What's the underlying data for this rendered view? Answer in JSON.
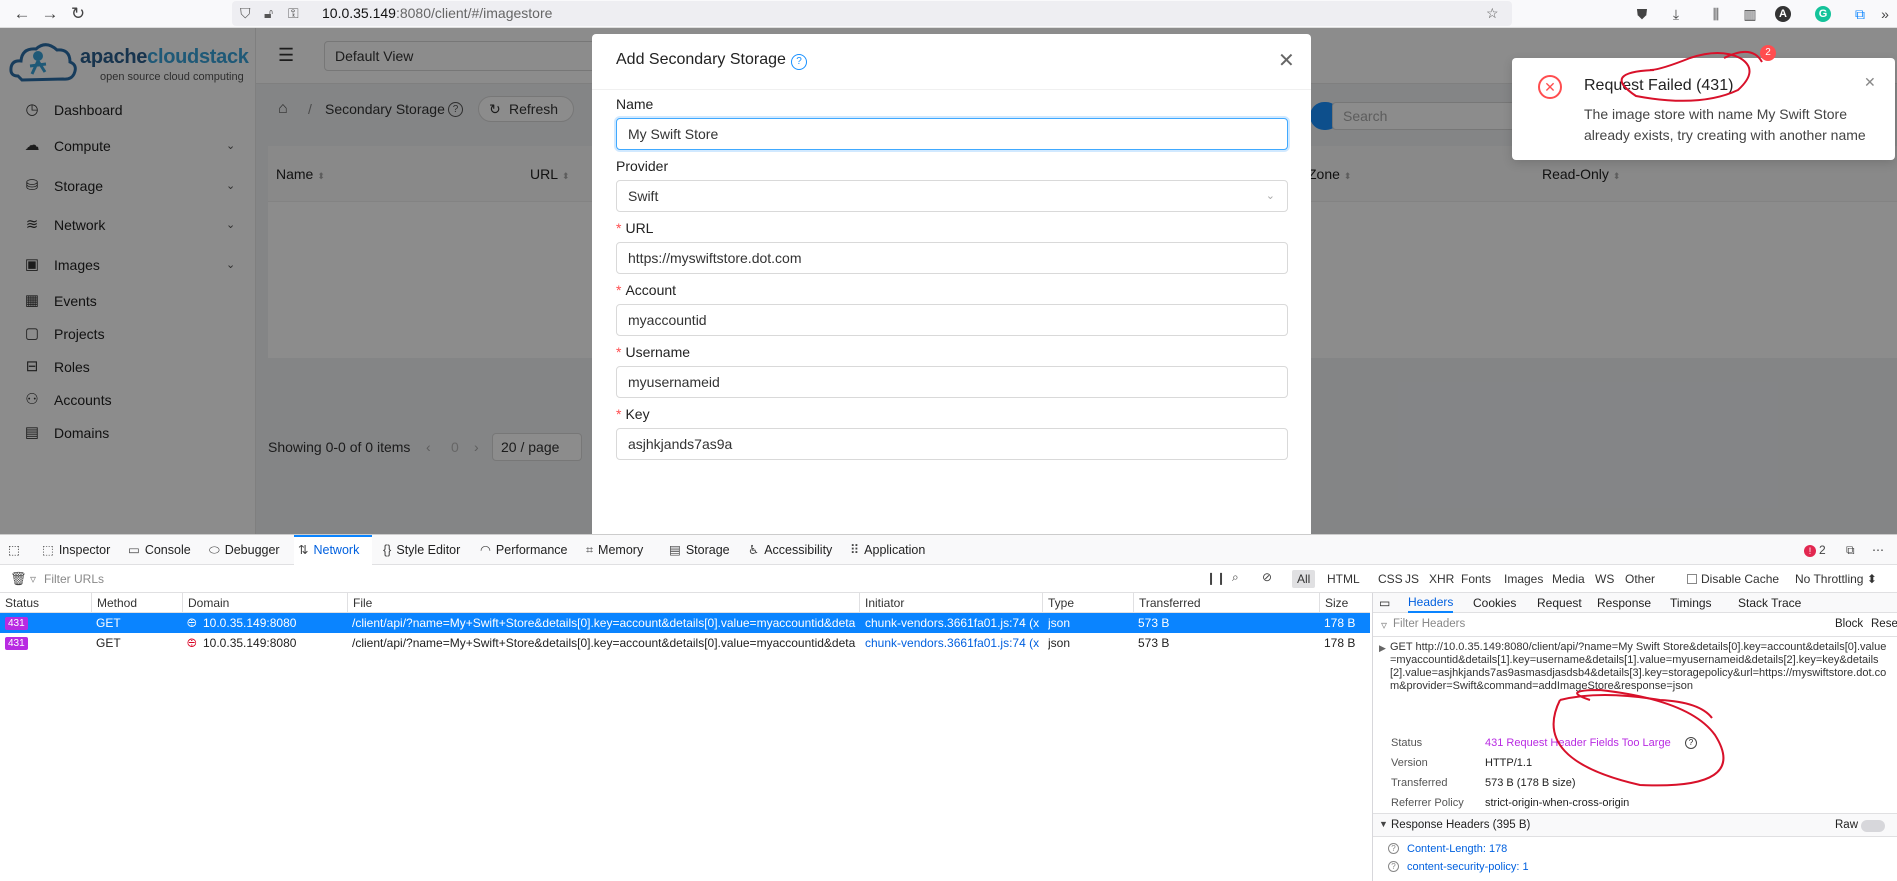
{
  "browser": {
    "url_host": "10.0.35.149",
    "url_rest": ":8080/client/#/imagestore",
    "notif_count": "2"
  },
  "app": {
    "logo_name_a": "apache",
    "logo_name_b": "cloudstack",
    "logo_tagline": "open source cloud computing",
    "view_select": "Default View",
    "menu": [
      {
        "label": "Dashboard",
        "icon": "dashboard-icon"
      },
      {
        "label": "Compute",
        "icon": "cloud-icon"
      },
      {
        "label": "Storage",
        "icon": "database-icon"
      },
      {
        "label": "Network",
        "icon": "wifi-icon"
      },
      {
        "label": "Images",
        "icon": "picture-icon"
      },
      {
        "label": "Events",
        "icon": "calendar-icon"
      },
      {
        "label": "Projects",
        "icon": "project-icon"
      },
      {
        "label": "Roles",
        "icon": "idcard-icon"
      },
      {
        "label": "Accounts",
        "icon": "team-icon"
      },
      {
        "label": "Domains",
        "icon": "block-icon"
      }
    ],
    "breadcrumb_title": "Secondary Storage",
    "refresh_label": "Refresh",
    "search_placeholder": "Search",
    "table_headers": {
      "name": "Name",
      "url": "URL",
      "zone": "Zone",
      "readonly": "Read-Only"
    },
    "pagination": {
      "showing": "Showing 0-0 of 0 items",
      "page": "0",
      "page_size": "20 / page"
    }
  },
  "modal": {
    "title": "Add Secondary Storage",
    "fields": {
      "name_label": "Name",
      "name_value": "My Swift Store",
      "provider_label": "Provider",
      "provider_value": "Swift",
      "url_label": "URL",
      "url_value": "https://myswiftstore.dot.com",
      "account_label": "Account",
      "account_value": "myaccountid",
      "username_label": "Username",
      "username_value": "myusernameid",
      "key_label": "Key",
      "key_value": "asjhkjands7as9a"
    }
  },
  "toast": {
    "title": "Request Failed (431)",
    "message": "The image store with name My Swift Store already exists, try creating with another name"
  },
  "devtools": {
    "tabs": [
      "Inspector",
      "Console",
      "Debugger",
      "Network",
      "Style Editor",
      "Performance",
      "Memory",
      "Storage",
      "Accessibility",
      "Application"
    ],
    "active_tab": "Network",
    "error_count": "2",
    "filter_placeholder": "Filter URLs",
    "types": [
      "All",
      "HTML",
      "CSS",
      "JS",
      "XHR",
      "Fonts",
      "Images",
      "Media",
      "WS",
      "Other"
    ],
    "disable_cache": "Disable Cache",
    "throttling": "No Throttling",
    "columns": [
      "Status",
      "Method",
      "Domain",
      "File",
      "Initiator",
      "Type",
      "Transferred",
      "Size"
    ],
    "rows": [
      {
        "status": "431",
        "method": "GET",
        "domain": "10.0.35.149:8080",
        "file": "/client/api/?name=My+Swift+Store&details[0].key=account&details[0].value=myaccountid&details",
        "initiator": "chunk-vendors.3661fa01.js:74 (x...",
        "type": "json",
        "transferred": "573 B",
        "size": "178 B"
      },
      {
        "status": "431",
        "method": "GET",
        "domain": "10.0.35.149:8080",
        "file": "/client/api/?name=My+Swift+Store&details[0].key=account&details[0].value=myaccountid&details",
        "initiator": "chunk-vendors.3661fa01.js:74 (x...",
        "type": "json",
        "transferred": "573 B",
        "size": "178 B"
      }
    ],
    "panel_tabs": [
      "Headers",
      "Cookies",
      "Request",
      "Response",
      "Timings",
      "Stack Trace"
    ],
    "panel_filter": "Filter Headers",
    "block_label": "Block",
    "resend_label": "Resen",
    "request_line": "GET http://10.0.35.149:8080/client/api/?name=My Swift Store&details[0].key=account&details[0].value=myaccountid&details[1].key=username&details[1].value=myusernameid&details[2].key=key&details[2].value=asjhkjands7as9asmasdjasdsb4&details[3].key=storagepolicy&url=https://myswiftstore.dot.com&provider=Swift&command=addImageStore&response=json",
    "status_label": "Status",
    "status_value": "431 Request Header Fields Too Large",
    "version_label": "Version",
    "version_value": "HTTP/1.1",
    "transferred_label": "Transferred",
    "transferred_value": "573 B (178 B size)",
    "referrer_label": "Referrer Policy",
    "referrer_value": "strict-origin-when-cross-origin",
    "resp_headers": "Response Headers (395 B)",
    "raw_label": "Raw",
    "header1": "Content-Length: 178",
    "header2": "content-security-policy: 1"
  }
}
